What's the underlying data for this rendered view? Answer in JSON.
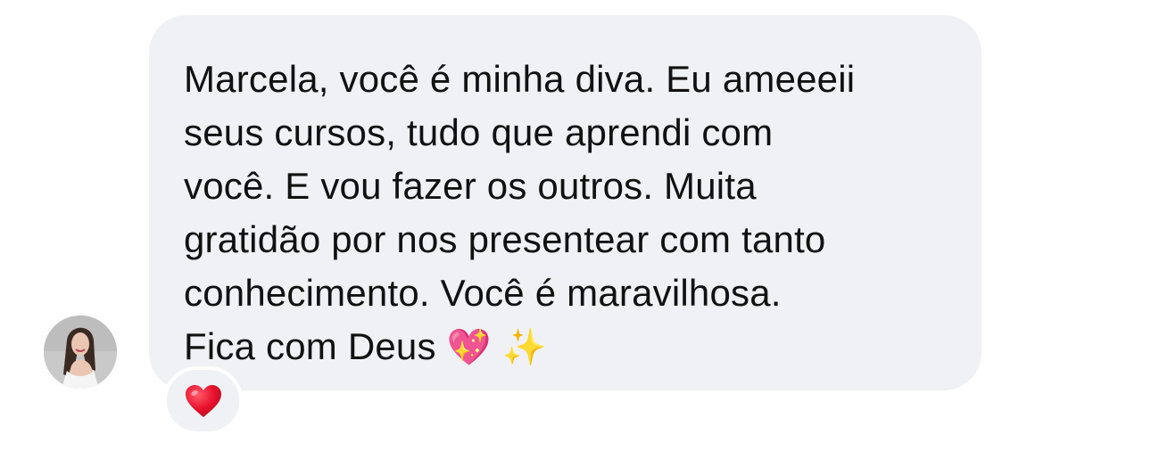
{
  "message": {
    "lines": [
      "Marcela, você é minha diva. Eu ameeeii",
      "seus cursos, tudo que aprendi com",
      "você. E vou fazer os outros. Muita",
      "gratidão por nos presentear com tanto",
      "conhecimento. Você é maravilhosa.",
      "Fica com Deus"
    ],
    "trailing_emojis": [
      "💖",
      "✨"
    ]
  },
  "reaction": {
    "emoji": "❤️"
  },
  "colors": {
    "bubble_background": "#f0f1f4",
    "text": "#111111",
    "reaction_heart": "#e8112d"
  },
  "icons": {
    "avatar": "sender-avatar-photo",
    "reaction": "red-heart-icon"
  }
}
